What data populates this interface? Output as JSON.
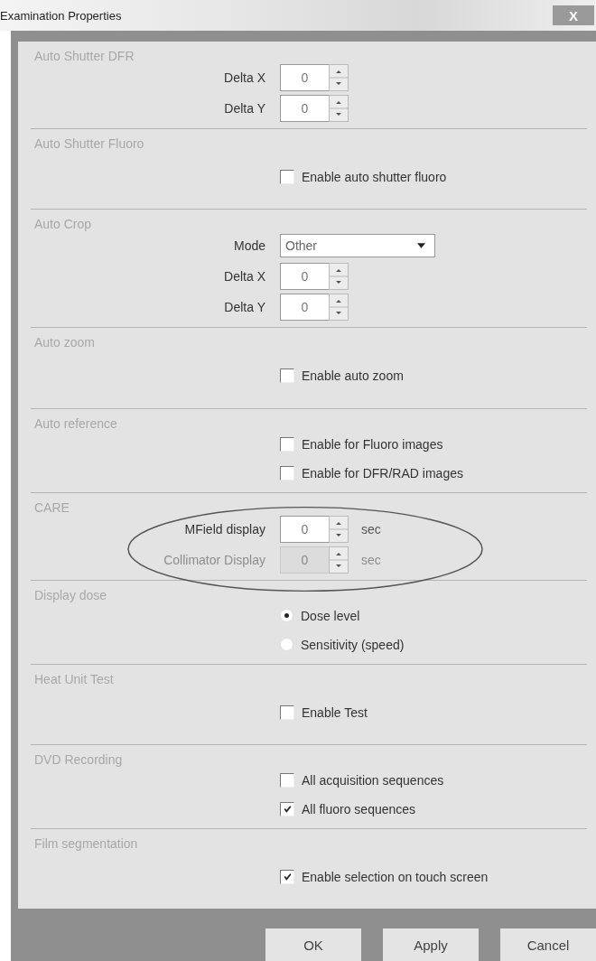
{
  "window": {
    "title": "Examination Properties",
    "close": "X"
  },
  "sections": [
    {
      "title": "Auto Shutter DFR",
      "rows": [
        {
          "kind": "spinner",
          "label": "Delta X",
          "value": "0",
          "disabled": false
        },
        {
          "kind": "spinner",
          "label": "Delta Y",
          "value": "0",
          "disabled": false
        }
      ]
    },
    {
      "title": "Auto Shutter Fluoro",
      "rows": [
        {
          "kind": "checkbox",
          "label": "Enable auto shutter fluoro",
          "checked": false
        }
      ]
    },
    {
      "title": "Auto Crop",
      "rows": [
        {
          "kind": "dropdown",
          "label": "Mode",
          "value": "Other"
        },
        {
          "kind": "spinner",
          "label": "Delta X",
          "value": "0",
          "disabled": false
        },
        {
          "kind": "spinner",
          "label": "Delta Y",
          "value": "0",
          "disabled": false
        }
      ]
    },
    {
      "title": "Auto zoom",
      "rows": [
        {
          "kind": "checkbox",
          "label": "Enable auto zoom",
          "checked": false
        }
      ]
    },
    {
      "title": "Auto reference",
      "rows": [
        {
          "kind": "checkbox",
          "label": "Enable for Fluoro images",
          "checked": false
        },
        {
          "kind": "checkbox",
          "label": "Enable for DFR/RAD images",
          "checked": false
        }
      ]
    },
    {
      "title": "CARE",
      "highlight": true,
      "rows": [
        {
          "kind": "spinner",
          "label": "MField display",
          "value": "0",
          "unit": "sec",
          "disabled": false
        },
        {
          "kind": "spinner",
          "label": "Collimator Display",
          "value": "0",
          "unit": "sec",
          "disabled": true
        }
      ]
    },
    {
      "title": "Display dose",
      "rows": [
        {
          "kind": "radio",
          "label": "Dose level",
          "selected": true
        },
        {
          "kind": "radio",
          "label": "Sensitivity (speed)",
          "selected": false
        }
      ]
    },
    {
      "title": "Heat Unit Test",
      "rows": [
        {
          "kind": "checkbox",
          "label": "Enable Test",
          "checked": false
        }
      ]
    },
    {
      "title": "DVD Recording",
      "rows": [
        {
          "kind": "checkbox",
          "label": "All acquisition sequences",
          "checked": false
        },
        {
          "kind": "checkbox",
          "label": "All fluoro sequences",
          "checked": true
        }
      ]
    },
    {
      "title": "Film segmentation",
      "rows": [
        {
          "kind": "checkbox",
          "label": "Enable selection on touch screen",
          "checked": true
        }
      ]
    }
  ],
  "buttons": [
    "OK",
    "Apply",
    "Cancel"
  ]
}
